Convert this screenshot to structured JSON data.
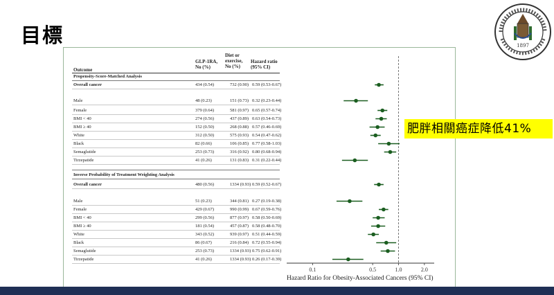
{
  "slide": {
    "title": "目標",
    "annotation": "肥胖相關癌症降低41%",
    "logo_year": "1897"
  },
  "table": {
    "headers": {
      "outcome": "Outcome",
      "glp1": "GLP-1RA,\nNo (%)",
      "diet": "Diet or\nexercise,\nNo (%)",
      "hr": "Hazard ratio\n(95% CI)"
    },
    "sections": [
      {
        "title": "Propensity-Score-Matched Analysis",
        "rows": [
          {
            "label": "Overall cancer",
            "glp1": "434 (0.54)",
            "diet": "732 (0.90)",
            "hr": "0.59 (0.53-0.67)",
            "bold": true
          },
          {
            "label": "Male",
            "glp1": "48  (0.23)",
            "diet": "151 (0.73)",
            "hr": "0.32 (0.23-0.44)"
          },
          {
            "label": "Female",
            "glp1": "379 (0.64)",
            "diet": "581 (0.97)",
            "hr": "0.65 (0.57-0.74)"
          },
          {
            "label": "BMI < 40",
            "glp1": "274 (0.56)",
            "diet": "437 (0.89)",
            "hr": "0.63 (0.54-0.73)"
          },
          {
            "label": "BMI ≥ 40",
            "glp1": "152 (0.50)",
            "diet": "268 (0.88)",
            "hr": "0.57 (0.46-0.69)"
          },
          {
            "label": "White",
            "glp1": "312 (0.50)",
            "diet": "575 (0.93)",
            "hr": "0.54 (0.47-0.62)"
          },
          {
            "label": "Black",
            "glp1": "82  (0.66)",
            "diet": "106 (0.85)",
            "hr": "0.77 (0.58-1.03)"
          },
          {
            "label": "Semaglutide",
            "glp1": "253 (0.73)",
            "diet": "316 (0.92)",
            "hr": "0.80 (0.68-0.94)"
          },
          {
            "label": "Tirzepatide",
            "glp1": "41  (0.26)",
            "diet": "131 (0.83)",
            "hr": "0.31 (0.22-0.44)"
          }
        ]
      },
      {
        "title": "Inverse Probability of Treatment Weighting Analysis",
        "rows": [
          {
            "label": "Overall cancer",
            "glp1": "480 (0.56)",
            "diet": "1334 (0.93)",
            "hr": "0.59 (0.52-0.67)",
            "bold": true
          },
          {
            "label": "Male",
            "glp1": "51 (0.23)",
            "diet": "344 (0.81)",
            "hr": "0.27 (0.19-0.38)"
          },
          {
            "label": "Female",
            "glp1": "429 (0.67)",
            "diet": "990 (0.99)",
            "hr": "0.67 (0.59-0.76)"
          },
          {
            "label": "BMI < 40",
            "glp1": "299 (0.56)",
            "diet": "877 (0.97)",
            "hr": "0.58 (0.50-0.69)"
          },
          {
            "label": "BMI ≥ 40",
            "glp1": "181 (0.54)",
            "diet": "457 (0.87)",
            "hr": "0.58 (0.48-0.70)"
          },
          {
            "label": "White",
            "glp1": "343 (0.52)",
            "diet": "939 (0.97)",
            "hr": "0.51 (0.44-0.59)"
          },
          {
            "label": "Black",
            "glp1": "86 (0.67)",
            "diet": "216 (0.84)",
            "hr": "0.72 (0.55-0.94)"
          },
          {
            "label": "Semaglutide",
            "glp1": "253 (0.73)",
            "diet": "1334 (0.93)",
            "hr": "0.75 (0.62-0.91)"
          },
          {
            "label": "Tirzepatide",
            "glp1": "41 (0.26)",
            "diet": "1334 (0.93)",
            "hr": "0.26 (0.17-0.39)"
          }
        ]
      }
    ]
  },
  "chart_data": {
    "type": "scatter",
    "xscale": "log",
    "xlim": [
      0.05,
      2.6
    ],
    "xticks": [
      "0.1",
      "0.5",
      "1.0",
      "2.0"
    ],
    "xtick_values": [
      0.1,
      0.5,
      1.0,
      2.0
    ],
    "reference_line": 1.0,
    "xlabel": "Hazard Ratio for Obesity-Associated Cancers (95% CI)",
    "marker_color": "#1b5e20",
    "points": [
      {
        "hr": 0.59,
        "lo": 0.53,
        "hi": 0.67
      },
      {
        "hr": 0.32,
        "lo": 0.23,
        "hi": 0.44
      },
      {
        "hr": 0.65,
        "lo": 0.57,
        "hi": 0.74
      },
      {
        "hr": 0.63,
        "lo": 0.54,
        "hi": 0.73
      },
      {
        "hr": 0.57,
        "lo": 0.46,
        "hi": 0.69
      },
      {
        "hr": 0.54,
        "lo": 0.47,
        "hi": 0.62
      },
      {
        "hr": 0.77,
        "lo": 0.58,
        "hi": 1.03
      },
      {
        "hr": 0.8,
        "lo": 0.68,
        "hi": 0.94
      },
      {
        "hr": 0.31,
        "lo": 0.22,
        "hi": 0.44
      },
      {
        "hr": 0.59,
        "lo": 0.52,
        "hi": 0.67
      },
      {
        "hr": 0.27,
        "lo": 0.19,
        "hi": 0.38
      },
      {
        "hr": 0.67,
        "lo": 0.59,
        "hi": 0.76
      },
      {
        "hr": 0.58,
        "lo": 0.5,
        "hi": 0.69
      },
      {
        "hr": 0.58,
        "lo": 0.48,
        "hi": 0.7
      },
      {
        "hr": 0.51,
        "lo": 0.44,
        "hi": 0.59
      },
      {
        "hr": 0.72,
        "lo": 0.55,
        "hi": 0.94
      },
      {
        "hr": 0.75,
        "lo": 0.62,
        "hi": 0.91
      },
      {
        "hr": 0.26,
        "lo": 0.17,
        "hi": 0.39
      }
    ]
  }
}
